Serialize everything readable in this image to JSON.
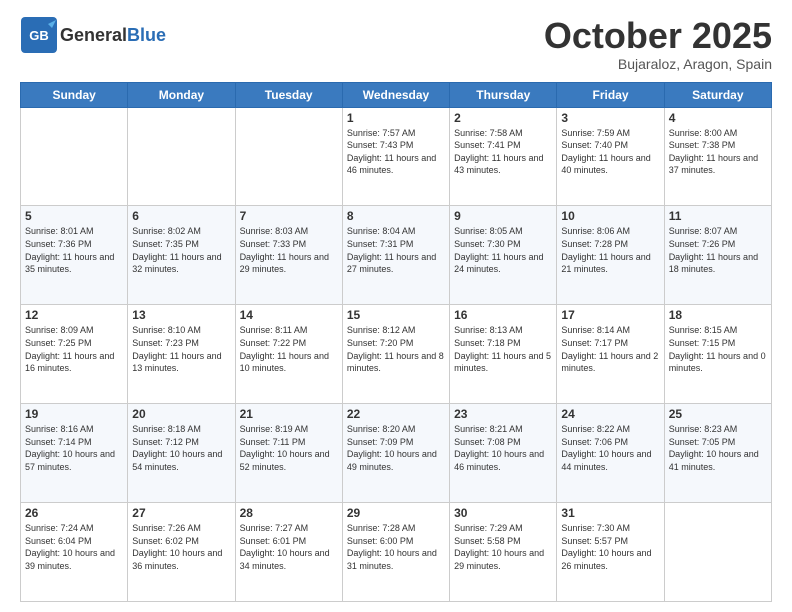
{
  "header": {
    "logo_general": "General",
    "logo_blue": "Blue",
    "month": "October 2025",
    "location": "Bujaraloz, Aragon, Spain"
  },
  "days_of_week": [
    "Sunday",
    "Monday",
    "Tuesday",
    "Wednesday",
    "Thursday",
    "Friday",
    "Saturday"
  ],
  "weeks": [
    [
      {
        "day": "",
        "info": ""
      },
      {
        "day": "",
        "info": ""
      },
      {
        "day": "",
        "info": ""
      },
      {
        "day": "1",
        "sunrise": "7:57 AM",
        "sunset": "7:43 PM",
        "daylight": "11 hours and 46 minutes."
      },
      {
        "day": "2",
        "sunrise": "7:58 AM",
        "sunset": "7:41 PM",
        "daylight": "11 hours and 43 minutes."
      },
      {
        "day": "3",
        "sunrise": "7:59 AM",
        "sunset": "7:40 PM",
        "daylight": "11 hours and 40 minutes."
      },
      {
        "day": "4",
        "sunrise": "8:00 AM",
        "sunset": "7:38 PM",
        "daylight": "11 hours and 37 minutes."
      }
    ],
    [
      {
        "day": "5",
        "sunrise": "8:01 AM",
        "sunset": "7:36 PM",
        "daylight": "11 hours and 35 minutes."
      },
      {
        "day": "6",
        "sunrise": "8:02 AM",
        "sunset": "7:35 PM",
        "daylight": "11 hours and 32 minutes."
      },
      {
        "day": "7",
        "sunrise": "8:03 AM",
        "sunset": "7:33 PM",
        "daylight": "11 hours and 29 minutes."
      },
      {
        "day": "8",
        "sunrise": "8:04 AM",
        "sunset": "7:31 PM",
        "daylight": "11 hours and 27 minutes."
      },
      {
        "day": "9",
        "sunrise": "8:05 AM",
        "sunset": "7:30 PM",
        "daylight": "11 hours and 24 minutes."
      },
      {
        "day": "10",
        "sunrise": "8:06 AM",
        "sunset": "7:28 PM",
        "daylight": "11 hours and 21 minutes."
      },
      {
        "day": "11",
        "sunrise": "8:07 AM",
        "sunset": "7:26 PM",
        "daylight": "11 hours and 18 minutes."
      }
    ],
    [
      {
        "day": "12",
        "sunrise": "8:09 AM",
        "sunset": "7:25 PM",
        "daylight": "11 hours and 16 minutes."
      },
      {
        "day": "13",
        "sunrise": "8:10 AM",
        "sunset": "7:23 PM",
        "daylight": "11 hours and 13 minutes."
      },
      {
        "day": "14",
        "sunrise": "8:11 AM",
        "sunset": "7:22 PM",
        "daylight": "11 hours and 10 minutes."
      },
      {
        "day": "15",
        "sunrise": "8:12 AM",
        "sunset": "7:20 PM",
        "daylight": "11 hours and 8 minutes."
      },
      {
        "day": "16",
        "sunrise": "8:13 AM",
        "sunset": "7:18 PM",
        "daylight": "11 hours and 5 minutes."
      },
      {
        "day": "17",
        "sunrise": "8:14 AM",
        "sunset": "7:17 PM",
        "daylight": "11 hours and 2 minutes."
      },
      {
        "day": "18",
        "sunrise": "8:15 AM",
        "sunset": "7:15 PM",
        "daylight": "11 hours and 0 minutes."
      }
    ],
    [
      {
        "day": "19",
        "sunrise": "8:16 AM",
        "sunset": "7:14 PM",
        "daylight": "10 hours and 57 minutes."
      },
      {
        "day": "20",
        "sunrise": "8:18 AM",
        "sunset": "7:12 PM",
        "daylight": "10 hours and 54 minutes."
      },
      {
        "day": "21",
        "sunrise": "8:19 AM",
        "sunset": "7:11 PM",
        "daylight": "10 hours and 52 minutes."
      },
      {
        "day": "22",
        "sunrise": "8:20 AM",
        "sunset": "7:09 PM",
        "daylight": "10 hours and 49 minutes."
      },
      {
        "day": "23",
        "sunrise": "8:21 AM",
        "sunset": "7:08 PM",
        "daylight": "10 hours and 46 minutes."
      },
      {
        "day": "24",
        "sunrise": "8:22 AM",
        "sunset": "7:06 PM",
        "daylight": "10 hours and 44 minutes."
      },
      {
        "day": "25",
        "sunrise": "8:23 AM",
        "sunset": "7:05 PM",
        "daylight": "10 hours and 41 minutes."
      }
    ],
    [
      {
        "day": "26",
        "sunrise": "7:24 AM",
        "sunset": "6:04 PM",
        "daylight": "10 hours and 39 minutes."
      },
      {
        "day": "27",
        "sunrise": "7:26 AM",
        "sunset": "6:02 PM",
        "daylight": "10 hours and 36 minutes."
      },
      {
        "day": "28",
        "sunrise": "7:27 AM",
        "sunset": "6:01 PM",
        "daylight": "10 hours and 34 minutes."
      },
      {
        "day": "29",
        "sunrise": "7:28 AM",
        "sunset": "6:00 PM",
        "daylight": "10 hours and 31 minutes."
      },
      {
        "day": "30",
        "sunrise": "7:29 AM",
        "sunset": "5:58 PM",
        "daylight": "10 hours and 29 minutes."
      },
      {
        "day": "31",
        "sunrise": "7:30 AM",
        "sunset": "5:57 PM",
        "daylight": "10 hours and 26 minutes."
      },
      {
        "day": "",
        "info": ""
      }
    ]
  ]
}
